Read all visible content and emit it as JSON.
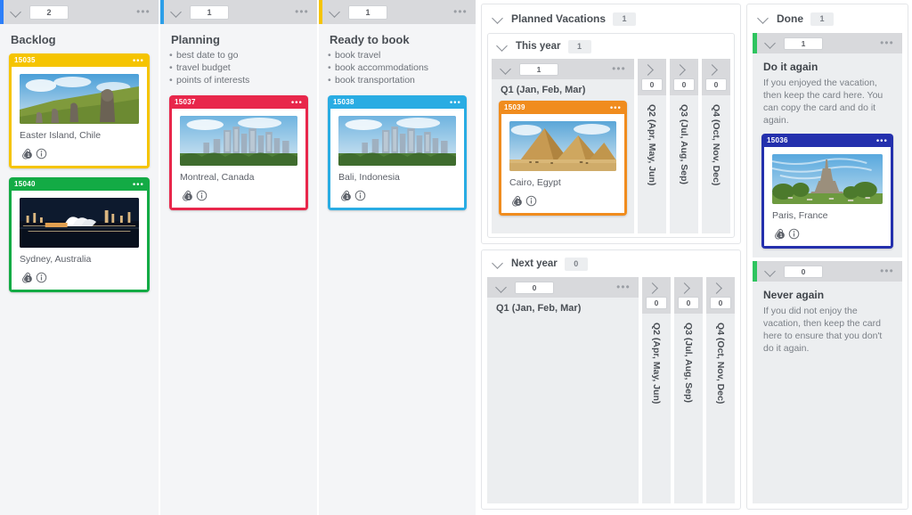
{
  "columns": [
    {
      "id": "backlog",
      "title": "Backlog",
      "count": "2",
      "accent_color": "#2d7ff9",
      "menu_icon": "•••",
      "description": [],
      "cards": [
        {
          "id": "15035",
          "title": "Easter Island, Chile",
          "color": "#f5c400",
          "image": "easter-island-moai",
          "attachments": "1",
          "menu_icon": "•••"
        },
        {
          "id": "15040",
          "title": "Sydney, Australia",
          "color": "#13ab45",
          "image": "sydney-opera-house-night",
          "attachments": "1",
          "menu_icon": "•••"
        }
      ]
    },
    {
      "id": "planning",
      "title": "Planning",
      "count": "1",
      "accent_color": "#2d9fe8",
      "menu_icon": "•••",
      "description": [
        "best date to go",
        "travel budget",
        "points of interests"
      ],
      "cards": [
        {
          "id": "15037",
          "title": "Montreal, Canada",
          "color": "#e8274b",
          "image": "montreal-skyline",
          "attachments": "1",
          "menu_icon": "•••"
        }
      ]
    },
    {
      "id": "ready-to-book",
      "title": "Ready to book",
      "count": "1",
      "accent_color": "#f5c400",
      "menu_icon": "•••",
      "description": [
        "book travel",
        "book accommodations",
        "book transportation"
      ],
      "cards": [
        {
          "id": "15038",
          "title": "Bali, Indonesia",
          "color": "#29ace3",
          "image": "bali-skyline",
          "attachments": "1",
          "menu_icon": "•••"
        }
      ]
    }
  ],
  "planned": {
    "title": "Planned Vacations",
    "count": "1",
    "lanes": [
      {
        "name": "This year",
        "count": "1",
        "quarter_open": {
          "label": "Q1 (Jan, Feb, Mar)",
          "count": "1",
          "menu_icon": "•••",
          "cards": [
            {
              "id": "15039",
              "title": "Cairo, Egypt",
              "color": "#f08c1e",
              "image": "giza-pyramids",
              "attachments": "1",
              "menu_icon": "•••"
            }
          ]
        },
        "quarters_collapsed": [
          {
            "label": "Q2 (Apr, May, Jun)",
            "count": "0"
          },
          {
            "label": "Q3 (Jul, Aug, Sep)",
            "count": "0"
          },
          {
            "label": "Q4 (Oct, Nov, Dec)",
            "count": "0"
          }
        ]
      },
      {
        "name": "Next year",
        "count": "0",
        "quarter_open": {
          "label": "Q1 (Jan, Feb, Mar)",
          "count": "0",
          "menu_icon": "•••",
          "cards": []
        },
        "quarters_collapsed": [
          {
            "label": "Q2 (Apr, May, Jun)",
            "count": "0"
          },
          {
            "label": "Q3 (Jul, Aug, Sep)",
            "count": "0"
          },
          {
            "label": "Q4 (Oct, Nov, Dec)",
            "count": "0"
          }
        ]
      }
    ]
  },
  "done": {
    "title": "Done",
    "count": "1",
    "accent_color": "#2ec45f",
    "lanes": [
      {
        "title": "Do it again",
        "count": "1",
        "menu_icon": "•••",
        "description": "If you enjoyed the vacation, then keep the card here. You can copy the card and do it again.",
        "cards": [
          {
            "id": "15036",
            "title": "Paris, France",
            "color": "#2430ad",
            "image": "eiffel-tower",
            "attachments": "1",
            "menu_icon": "•••"
          }
        ]
      },
      {
        "title": "Never again",
        "count": "0",
        "menu_icon": "•••",
        "description": "If you did not enjoy the vacation, then keep the card here to ensure that you don't do it again.",
        "cards": []
      }
    ]
  }
}
